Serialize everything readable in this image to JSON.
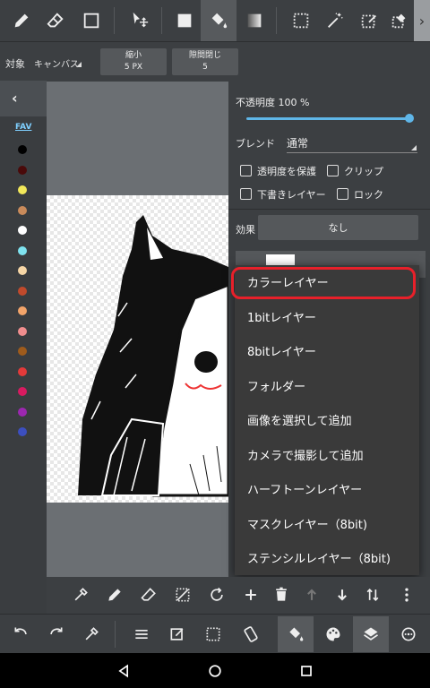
{
  "option_bar": {
    "target_label": "対象",
    "target_value": "キャンバス",
    "shrink_label": "縮小",
    "shrink_value": "5 PX",
    "gap_close_label": "隙間閉じ",
    "gap_close_value": "5"
  },
  "palette": {
    "fav_label": "FAV",
    "colors": [
      "#000000",
      "#4a0a0a",
      "#f2e85a",
      "#c98b5b",
      "#ffffff",
      "#7fe3ef",
      "#f6d6a6",
      "#c04a2c",
      "#f2a46a",
      "#f08e8e",
      "#9e5b1c",
      "#e33a3a",
      "#d81b60",
      "#9c27b0",
      "#3c4fbf"
    ]
  },
  "panel": {
    "opacity_label": "不透明度 100 %",
    "opacity_value": 100,
    "blend_label": "ブレンド",
    "blend_value": "通常",
    "protect_alpha_label": "透明度を保護",
    "clip_label": "クリップ",
    "draft_layer_label": "下書きレイヤー",
    "lock_label": "ロック",
    "effect_label": "効果",
    "effect_value": "なし"
  },
  "menu": {
    "items": [
      "カラーレイヤー",
      "1bitレイヤー",
      "8bitレイヤー",
      "フォルダー",
      "画像を選択して追加",
      "カメラで撮影して追加",
      "ハーフトーンレイヤー",
      "マスクレイヤー（8bit)",
      "ステンシルレイヤー（8bit)"
    ],
    "highlighted_index": 0,
    "highlight_color": "#e8202a"
  },
  "colors": {
    "accent": "#5fb6e8",
    "toolbar_bg": "#3c3f42",
    "menu_bg": "#3a3a3a"
  }
}
